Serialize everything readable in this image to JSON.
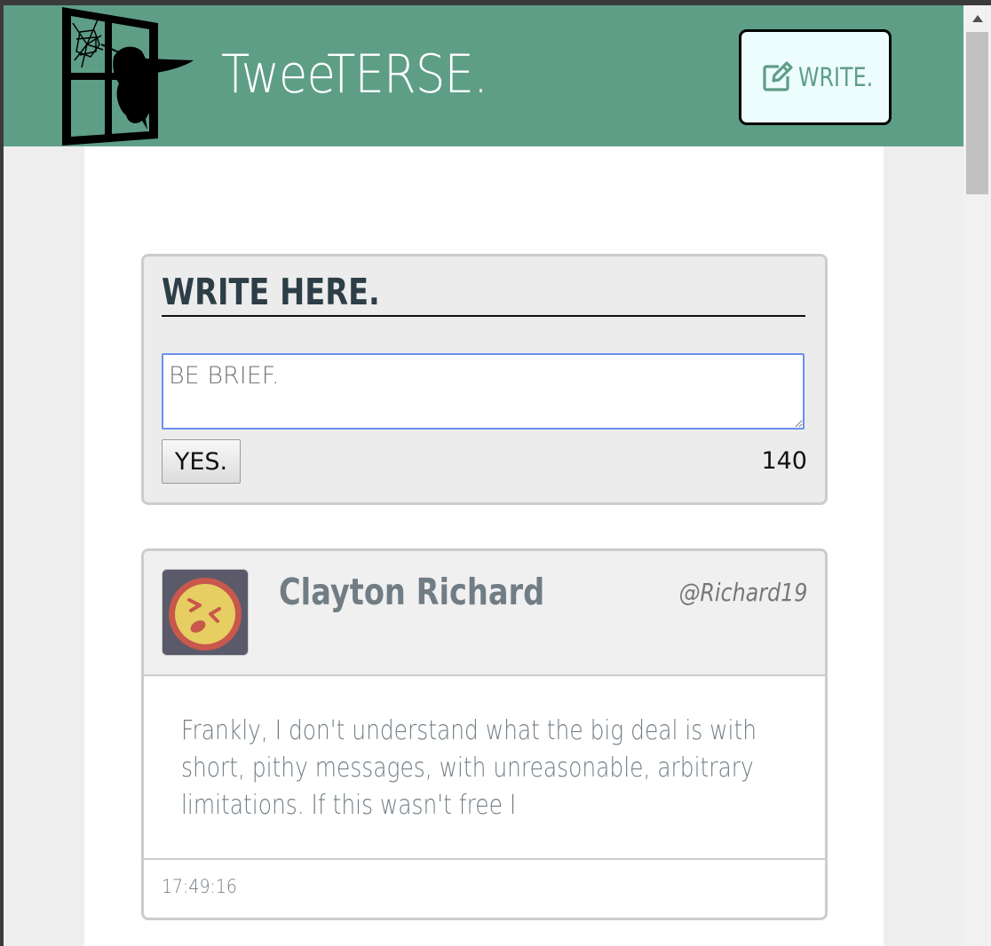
{
  "header": {
    "app_title": "TweeTERSE.",
    "write_button_label": "WRITE.",
    "write_button_icon": "edit-icon",
    "brand_color": "#5e9e86"
  },
  "compose": {
    "title": "WRITE HERE.",
    "placeholder": "BE BRIEF.",
    "value": "",
    "submit_label": "YES.",
    "chars_remaining": "140"
  },
  "tweets": [
    {
      "author_name": "Clayton Richard",
      "handle": "@Richard19",
      "avatar_icon": "laughing-face-icon",
      "text": "Frankly, I don't understand what the big deal is with short, pithy messages, with unreasonable, arbitrary limitations. If this wasn't free I",
      "timestamp": "17:49:16"
    }
  ]
}
